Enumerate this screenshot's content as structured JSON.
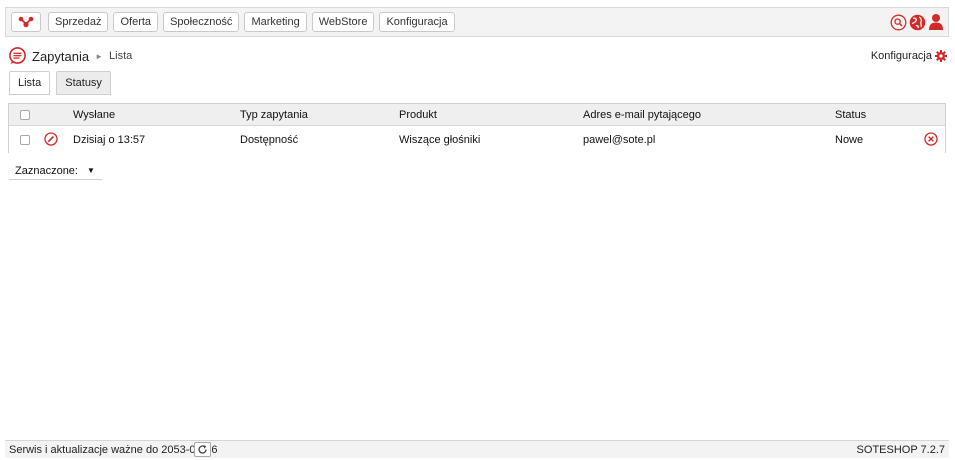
{
  "colors": {
    "accent": "#d32a2a",
    "bar": "#f3f3f3"
  },
  "topbar": {
    "logo_icon": "graph-nodes-icon",
    "nav": [
      "Sprzedaż",
      "Oferta",
      "Społeczność",
      "Marketing",
      "WebStore",
      "Konfiguracja"
    ],
    "icons": [
      "search-icon",
      "globe-icon",
      "user-icon"
    ]
  },
  "breadcrumb": {
    "icon": "speech-bubble-icon",
    "main": "Zapytania",
    "separator": "►",
    "sub": "Lista"
  },
  "config_link": {
    "label": "Konfiguracja",
    "icon": "gear-icon"
  },
  "tabs": [
    "Lista",
    "Statusy"
  ],
  "table": {
    "columns": [
      "Wysłane",
      "Typ zapytania",
      "Produkt",
      "Adres e-mail pytającego",
      "Status"
    ],
    "rows": [
      {
        "sent": "Dzisiaj o 13:57",
        "type": "Dostępność",
        "product": "Wiszące głośniki",
        "email": "pawel@sote.pl",
        "status": "Nowe"
      }
    ]
  },
  "selected_action": {
    "label": "Zaznaczone:",
    "arrow": "▼"
  },
  "footer": {
    "service_text": "Serwis i aktualizacje ważne do 2053-08-26",
    "version": "SOTESHOP 7.2.7"
  }
}
